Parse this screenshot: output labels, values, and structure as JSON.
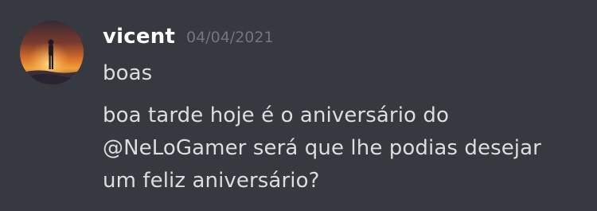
{
  "message": {
    "author": "vicent",
    "timestamp": "04/04/2021",
    "lines": [
      "boas"
    ],
    "body": {
      "before_mention": "boa tarde hoje é o aniversário do",
      "mention": "@NeLoGamer",
      "after_mention_line2": " será que lhe podias desejar",
      "line3": "um feliz aniversário?"
    }
  },
  "colors": {
    "background": "#36393f",
    "username": "#ffffff",
    "timestamp": "#72767d",
    "text": "#dcddde"
  },
  "icons": {
    "avatar": "user-avatar-sunset-figure"
  }
}
